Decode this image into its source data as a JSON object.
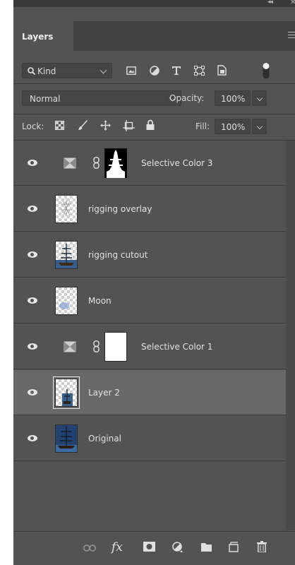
{
  "panel": {
    "tab_label": "Layers",
    "collapse_glyph": "◂◂",
    "close_glyph": "✕"
  },
  "filter": {
    "kind_label": "Kind",
    "icons": [
      "image-filter-icon",
      "adjustment-filter-icon",
      "type-filter-icon",
      "shape-filter-icon",
      "smart-object-filter-icon",
      "filter-toggle-icon"
    ]
  },
  "blend": {
    "mode": "Normal",
    "opacity_label": "Opacity:",
    "opacity_value": "100%"
  },
  "lock": {
    "label": "Lock:",
    "fill_label": "Fill:",
    "fill_value": "100%"
  },
  "layers": [
    {
      "name": "Selective Color 3",
      "type": "adjustment",
      "mask": "ship-silhouette",
      "visible": true,
      "selected": false
    },
    {
      "name": "rigging overlay",
      "type": "pixel",
      "visible": true,
      "selected": false
    },
    {
      "name": "rigging cutout",
      "type": "pixel",
      "visible": true,
      "selected": false
    },
    {
      "name": "Moon",
      "type": "pixel",
      "visible": true,
      "selected": false
    },
    {
      "name": "Selective Color 1",
      "type": "adjustment",
      "mask": "white",
      "visible": true,
      "selected": false
    },
    {
      "name": "Layer 2",
      "type": "pixel",
      "visible": true,
      "selected": true
    },
    {
      "name": "Original",
      "type": "pixel",
      "visible": true,
      "selected": false
    }
  ],
  "footer": {
    "fx_label": "fx",
    "icons": [
      "link-layers-icon",
      "fx-icon",
      "add-mask-icon",
      "new-adjustment-icon",
      "new-group-icon",
      "new-layer-icon",
      "trash-icon"
    ]
  },
  "colors": {
    "panel_bg": "#535353",
    "selected_bg": "#686868",
    "field_bg": "#454545"
  }
}
